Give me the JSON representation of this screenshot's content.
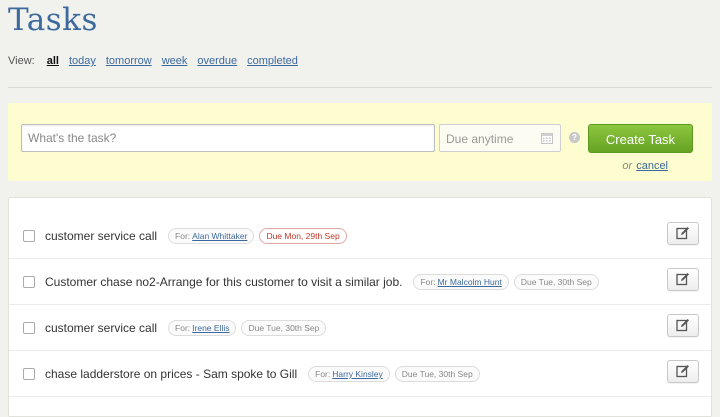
{
  "page": {
    "title": "Tasks"
  },
  "view": {
    "label": "View:",
    "filters": [
      {
        "label": "all",
        "active": true
      },
      {
        "label": "today",
        "active": false
      },
      {
        "label": "tomorrow",
        "active": false
      },
      {
        "label": "week",
        "active": false
      },
      {
        "label": "overdue",
        "active": false
      },
      {
        "label": "completed",
        "active": false
      }
    ]
  },
  "form": {
    "task_placeholder": "What's the task?",
    "due_placeholder": "Due anytime",
    "help_glyph": "?",
    "create_label": "Create Task",
    "or_label": "or",
    "cancel_label": "cancel"
  },
  "tasks": [
    {
      "text": "customer service call",
      "for_label": "For:",
      "for_name": "Alan Whittaker",
      "due": "Due Mon, 29th Sep",
      "overdue": true
    },
    {
      "text": "Customer chase no2-Arrange for this customer to visit a similar job.",
      "for_label": "For:",
      "for_name": "Mr Malcolm Hunt",
      "due": "Due Tue, 30th Sep",
      "overdue": false
    },
    {
      "text": "customer service call",
      "for_label": "For:",
      "for_name": "Irene Ellis",
      "due": "Due Tue, 30th Sep",
      "overdue": false
    },
    {
      "text": "chase ladderstore on prices - Sam spoke to Gill",
      "for_label": "For:",
      "for_name": "Harry Kinsley",
      "due": "Due Tue, 30th Sep",
      "overdue": false
    }
  ],
  "colors": {
    "accent": "#3d6a9c",
    "create_green": "#7ab530",
    "overdue_red": "#c0392b",
    "form_bg": "#fdfdcf"
  },
  "icons": {
    "calendar": "calendar-icon",
    "edit": "edit-icon",
    "help": "help-icon"
  }
}
